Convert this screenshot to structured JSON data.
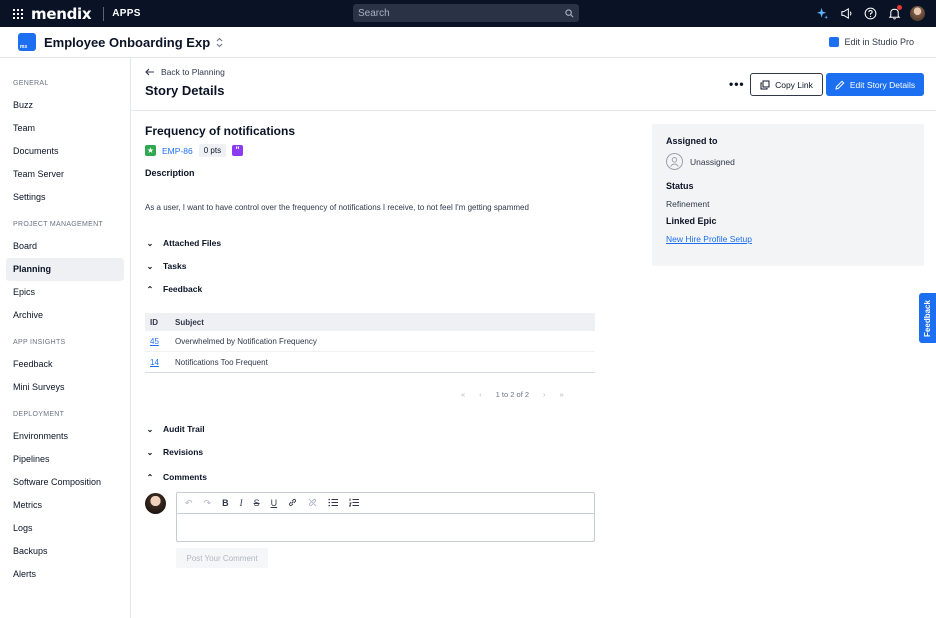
{
  "topbar": {
    "logo": "mendix",
    "apps_label": "APPS",
    "search_placeholder": "Search"
  },
  "app": {
    "title": "Employee Onboarding Exp",
    "edit_in_studio": "Edit in Studio Pro"
  },
  "sidebar": {
    "sections": [
      {
        "title": "GENERAL",
        "items": [
          "Buzz",
          "Team",
          "Documents",
          "Team Server",
          "Settings"
        ]
      },
      {
        "title": "PROJECT MANAGEMENT",
        "items": [
          "Board",
          "Planning",
          "Epics",
          "Archive"
        ]
      },
      {
        "title": "APP INSIGHTS",
        "items": [
          "Feedback",
          "Mini Surveys"
        ]
      },
      {
        "title": "DEPLOYMENT",
        "items": [
          "Environments",
          "Pipelines",
          "Software Composition",
          "Metrics",
          "Logs",
          "Backups",
          "Alerts"
        ]
      }
    ],
    "active": "Planning"
  },
  "header": {
    "back_label": "Back to Planning",
    "title": "Story Details",
    "more": "•••",
    "copy_link": "Copy Link",
    "edit_story": "Edit Story Details"
  },
  "story": {
    "title": "Frequency of notifications",
    "id": "EMP-86",
    "points": "0 pts",
    "description_label": "Description",
    "description": "As a user, I want to have control over the frequency of notifications I receive, to not feel I'm getting spammed"
  },
  "sections": {
    "attached_files": "Attached Files",
    "tasks": "Tasks",
    "feedback": "Feedback",
    "audit_trail": "Audit Trail",
    "revisions": "Revisions",
    "comments": "Comments"
  },
  "feedback_table": {
    "headers": [
      "ID",
      "Subject"
    ],
    "rows": [
      {
        "id": "45",
        "subject": "Overwhelmed by Notification Frequency"
      },
      {
        "id": "14",
        "subject": "Notifications Too Frequent"
      }
    ],
    "pager": "1 to 2 of 2"
  },
  "comment": {
    "post_label": "Post Your Comment"
  },
  "panel": {
    "assigned_label": "Assigned to",
    "assignee": "Unassigned",
    "status_label": "Status",
    "status": "Refinement",
    "epic_label": "Linked Epic",
    "epic": "New Hire Profile Setup"
  },
  "feedback_tab": "Feedback",
  "colors": {
    "topbar": "#0a1325",
    "primary": "#1d6ff2",
    "story_badge": "#2fa84f",
    "quote_badge": "#8b3cf0"
  }
}
